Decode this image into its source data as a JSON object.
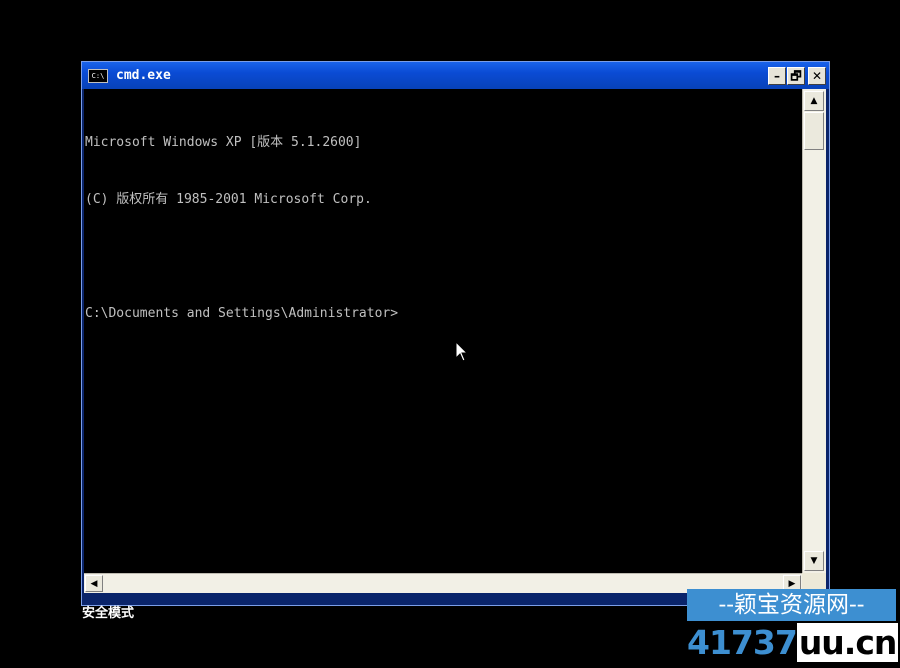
{
  "window": {
    "title": "cmd.exe",
    "icon_label": "C:\\",
    "minimize_label": "–",
    "restore_label": "🗗",
    "close_label": "✕"
  },
  "console": {
    "lines": [
      "Microsoft Windows XP [版本 5.1.2600]",
      "(C) 版权所有 1985-2001 Microsoft Corp.",
      "",
      "C:\\Documents and Settings\\Administrator>"
    ]
  },
  "scrollbar": {
    "up_arrow": "▲",
    "down_arrow": "▼",
    "left_arrow": "◀",
    "right_arrow": "▶"
  },
  "status": {
    "safe_mode": "安全模式"
  },
  "watermark": {
    "top": "--颖宝资源网--",
    "number": "41737",
    "domain": "uu.cn"
  },
  "colors": {
    "titlebar": "#0a4bd4",
    "console_bg": "#000000",
    "console_text": "#c0c0c0",
    "watermark_blue": "#3d8fd1"
  }
}
